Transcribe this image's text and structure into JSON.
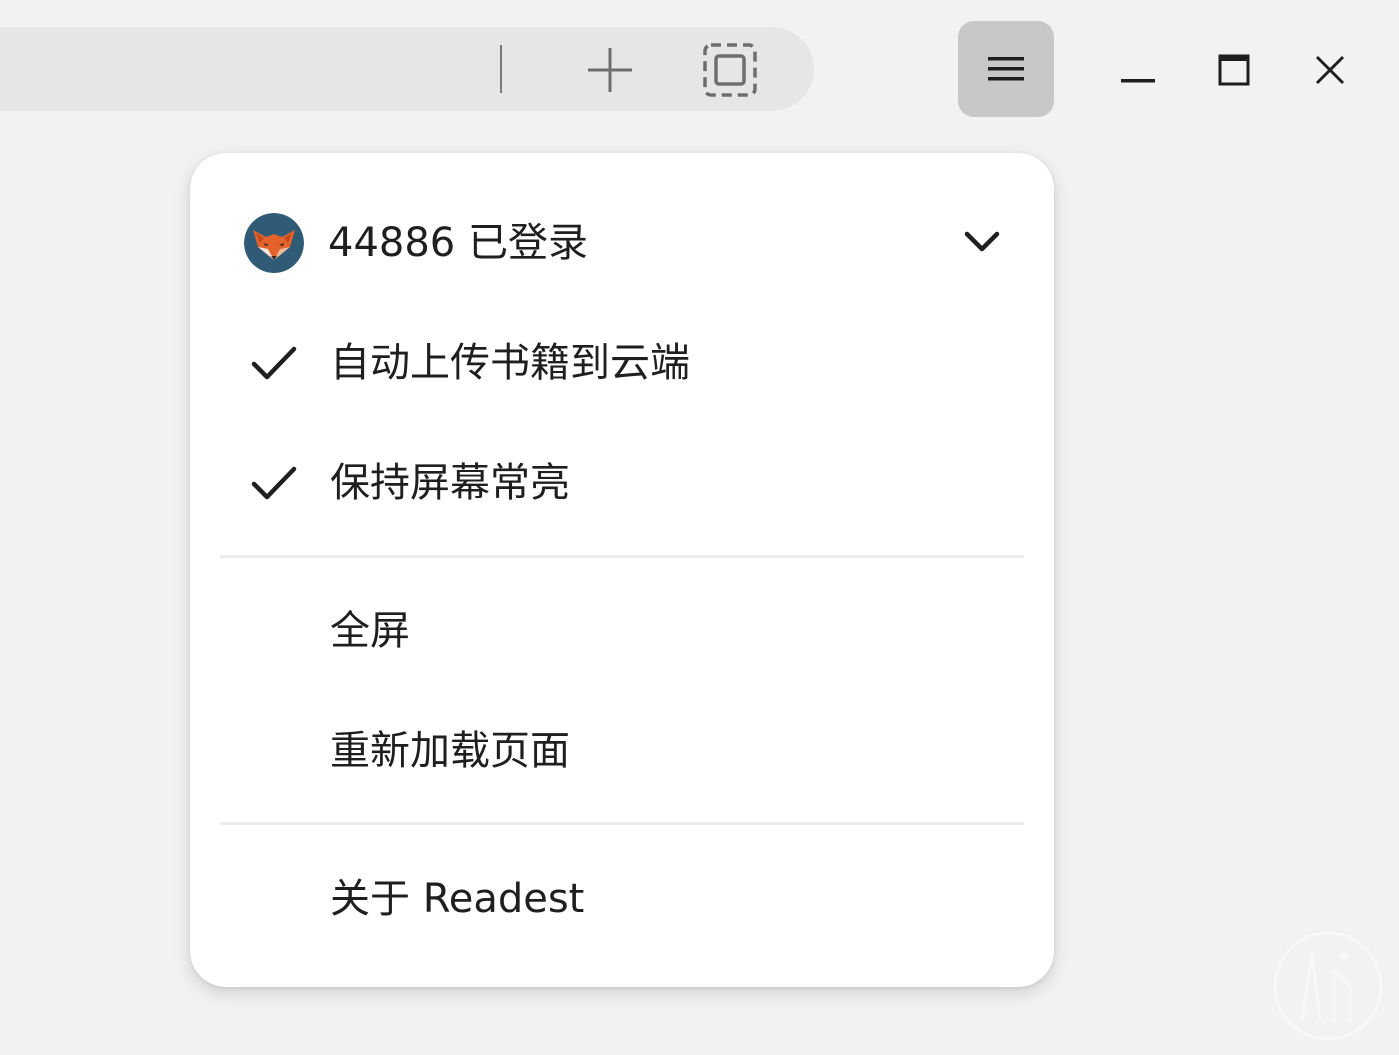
{
  "titlebar": {
    "add_tab_icon": "plus-icon",
    "fit_icon": "fit-screen-icon",
    "menu_icon": "hamburger-icon",
    "minimize_icon": "minimize-icon",
    "maximize_icon": "maximize-icon",
    "close_icon": "close-icon"
  },
  "menu": {
    "account": {
      "label": "44886 已登录",
      "avatar_icon": "fox-avatar-icon",
      "expand_icon": "chevron-down-icon"
    },
    "items": [
      {
        "label": "自动上传书籍到云端",
        "checked": true
      },
      {
        "label": "保持屏幕常亮",
        "checked": true
      },
      {
        "label": "全屏",
        "checked": false
      },
      {
        "label": "重新加载页面",
        "checked": false
      },
      {
        "label": "关于 Readest",
        "checked": false
      }
    ]
  },
  "colors": {
    "background": "#f2f2f2",
    "menu_button_active": "#c8c8c8",
    "dropdown_bg": "#ffffff",
    "avatar_bg": "#2f5b77",
    "fox_orange": "#e4622c"
  }
}
